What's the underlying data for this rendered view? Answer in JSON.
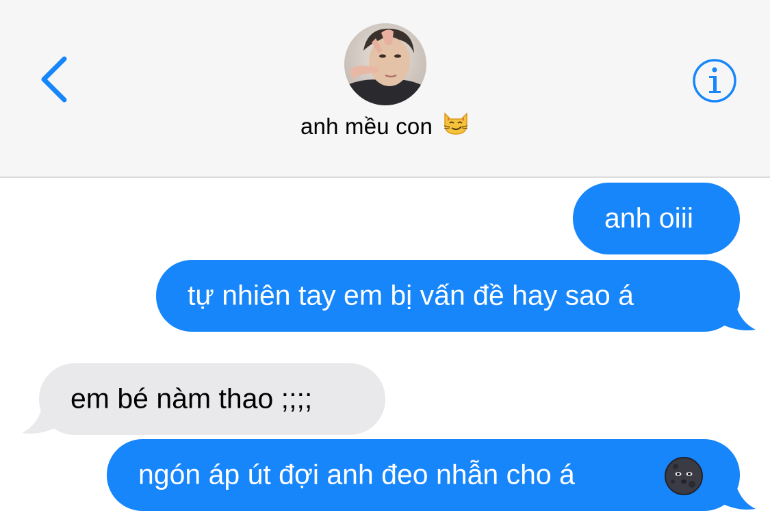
{
  "header": {
    "contact_name": "anh mều con",
    "contact_emoji": "smirking-cat",
    "back_icon": "chevron-left-icon",
    "info_icon": "info-circle-icon",
    "accent_color": "#1786fb"
  },
  "messages": [
    {
      "side": "sent",
      "text": "anh oiii"
    },
    {
      "side": "sent",
      "text": "tự nhiên tay em bị vấn đề hay sao á"
    },
    {
      "side": "received",
      "text": "em bé nàm thao ;;;;"
    },
    {
      "side": "sent",
      "text": "ngón áp út đợi anh đeo nhẫn cho á",
      "emoji": "new-moon-face"
    }
  ],
  "colors": {
    "sent_bubble": "#1786fb",
    "received_bubble": "#e9e9eb",
    "header_bg": "#f6f6f6"
  }
}
